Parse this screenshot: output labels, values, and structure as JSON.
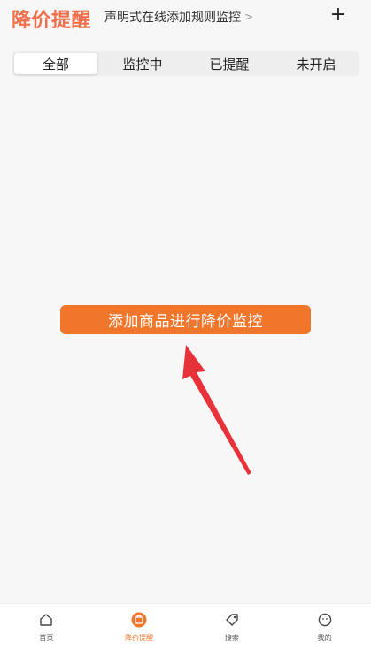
{
  "header": {
    "title": "降价提醒",
    "rule_text": "声明式在线添加规则监控",
    "chevron": ">",
    "add_label": "+"
  },
  "tabs": [
    {
      "label": "全部",
      "active": true
    },
    {
      "label": "监控中",
      "active": false
    },
    {
      "label": "已提醒",
      "active": false
    },
    {
      "label": "未开启",
      "active": false
    }
  ],
  "cta": {
    "label": "添加商品进行降价监控"
  },
  "bottom_nav": [
    {
      "label": "首页",
      "icon": "home-icon",
      "active": false
    },
    {
      "label": "降价提醒",
      "icon": "price-alert-icon",
      "active": true
    },
    {
      "label": "搜索",
      "icon": "tag-icon",
      "active": false
    },
    {
      "label": "我的",
      "icon": "profile-icon",
      "active": false
    }
  ],
  "colors": {
    "accent": "#f0762c",
    "title": "#f1704b",
    "arrow": "#e8323a",
    "background": "#f7f7f7"
  }
}
